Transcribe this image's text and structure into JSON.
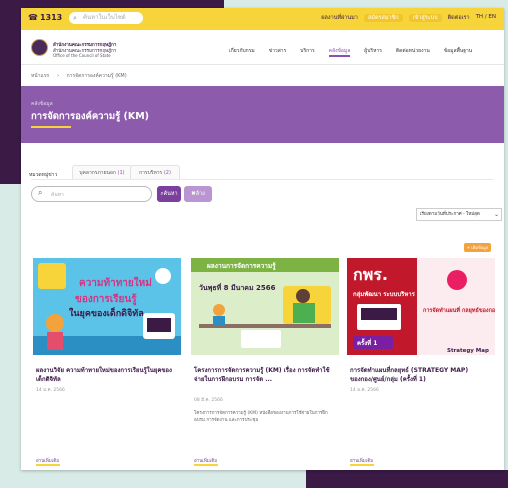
{
  "utility": {
    "phone": "1313",
    "search_placeholder": "ค้นหาในเว็บไซต์",
    "links": [
      "ผลงานที่ผ่านมา",
      "สมัครสมาชิก",
      "เข้าสู่ระบบ",
      "ติดต่อเรา"
    ],
    "language": "TH / EN"
  },
  "header": {
    "org_th": "สำนักงานคณะกรรมการกฤษฎีกา",
    "org_th2": "สำนักงานคณะกรรมการกฤษฎีกา",
    "org_en": "Office of the Council of State",
    "nav": [
      "เกี่ยวกับกรม",
      "ข่าวสาร",
      "บริการ",
      "คลังข้อมูล",
      "ผู้บริหาร",
      "ติดต่อหน่วยงาน",
      "ข้อมูลพื้นฐาน"
    ],
    "active_nav_index": 3
  },
  "breadcrumb": [
    "หน้าแรก",
    "การจัดการองค์ความรู้ (KM)"
  ],
  "banner": {
    "small": "คลังข้อมูล",
    "title": "การจัดการองค์ความรู้ (KM)"
  },
  "filter": {
    "label": "หมวดหมู่ข่าว",
    "tabs": [
      {
        "label": "บุคลากรภายนอก",
        "count": "(1)"
      },
      {
        "label": "การบริหาร",
        "count": "(2)"
      }
    ]
  },
  "search": {
    "placeholder": "ค้นหา",
    "search_label": "ค้นหา",
    "clear_label": "ล้าง"
  },
  "sort": {
    "selected": "เรียงตามวันที่ประกาศ - ใหม่สุด"
  },
  "add_label": "+ เพิ่มข้อมูล",
  "cards": [
    {
      "title": "ผลงานวิจัย ความท้าทายใหม่ของการเรียนรู้ในยุคของเด็กดิจิทัล",
      "date": "14 ม.ค. 2566",
      "desc": "",
      "more": "อ่านเพิ่มเติม"
    },
    {
      "title": "โครงการการจัดการความรู้ (KM) เรื่อง การจัดทำใช้จ่ายในการฝึกอบรม การจัด ...",
      "date": "08 มี.ค. 2566",
      "desc": "โครงการการจัดการความรู้ (KM) หนังสือของงานการใช้จ่ายในการฝึกอบรม การจัดงาน และการประชุม",
      "more": "อ่านเพิ่มเติม"
    },
    {
      "title": "การจัดทำแผนที่กลยุทธ์ (STRATEGY MAP) ของกอง/ศูนย์/กลุ่ม (ครั้งที่ 1)",
      "date": "14 ม.ค. 2566",
      "desc": "",
      "more": "อ่านเพิ่มเติม"
    }
  ],
  "thumbs": {
    "card1_text1": "ความท้าทายใหม่",
    "card1_text2": "ของการเรียนรู้",
    "card1_text3": "ในยุคของเด็กดิจิทัล",
    "card2_header": "ผลงานการจัดการความรู้",
    "card2_date": "วันพุธที่ 8 มีนาคม 2566",
    "card3_brand": "กพร.",
    "card3_sub": "กลุ่มพัฒนา ระบบบริหาร",
    "card3_round": "ครั้งที่ 1",
    "card3_right": "การจัดทำแผนที่ กลยุทธ์ของกอง ศูนย์/กลุ่ม",
    "card3_map": "Strategy Map"
  },
  "colors": {
    "yellow": "#f6d43a",
    "purple_banner": "#8d5bac",
    "dark_purple": "#3b1a46",
    "button_purple": "#7b3f9e",
    "orange": "#f4a23b"
  }
}
